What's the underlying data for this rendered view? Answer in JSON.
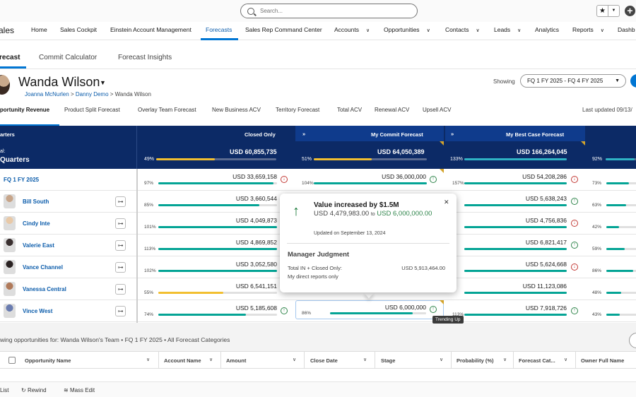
{
  "search": {
    "placeholder": "Search..."
  },
  "topbar": {
    "favorite_icon": "star-icon",
    "favorite_menu_icon": "chevron-down-icon",
    "add_icon": "plus-icon"
  },
  "nav": {
    "app_name": "ales",
    "items": [
      {
        "label": "Home",
        "chevron": false
      },
      {
        "label": "Sales Cockpit",
        "chevron": false
      },
      {
        "label": "Einstein Account Management",
        "chevron": false
      },
      {
        "label": "Forecasts",
        "chevron": false,
        "active": true
      },
      {
        "label": "Sales Rep Command Center",
        "chevron": false
      },
      {
        "label": "Accounts",
        "chevron": true
      },
      {
        "label": "Opportunities",
        "chevron": true
      },
      {
        "label": "Contacts",
        "chevron": true
      },
      {
        "label": "Leads",
        "chevron": true
      },
      {
        "label": "Analytics",
        "chevron": false
      },
      {
        "label": "Reports",
        "chevron": true
      },
      {
        "label": "Dashb",
        "chevron": false
      }
    ]
  },
  "subtabs": [
    "recast",
    "Commit Calculator",
    "Forecast Insights"
  ],
  "header": {
    "name": "Wanda Wilson",
    "breadcrumb": [
      "Joanna McNurlen",
      "Danny Demo",
      "Wanda Wilson"
    ],
    "breadcrumb_sep": ">",
    "showing_label": "Showing",
    "period": "FQ 1 FY 2025 - FQ 4 FY 2025",
    "forecast_tabs": [
      "pportunity Revenue",
      "Product Split Forecast",
      "Overlay Team Forecast",
      "New Business ACV",
      "Territory Forecast",
      "Total ACV",
      "Renewal ACV",
      "Upsell ACV"
    ],
    "last_updated": "Last updated 09/13/"
  },
  "grid": {
    "col0_label": "arters",
    "total_label": "al:",
    "total_sub": "Quarters",
    "columns": [
      {
        "label": "Closed Only",
        "total": "USD 60,855,735",
        "pct": "49%",
        "fill": 0.49
      },
      {
        "label": "My Commit Forecast",
        "total": "USD 64,050,389",
        "pct": "51%",
        "fill": 0.51
      },
      {
        "label": "My Best Case Forecast",
        "total": "USD 166,264,045",
        "pct": "133%",
        "fill": 1.0
      },
      {
        "label": "",
        "total": "",
        "pct": "92%",
        "fill": 0.92
      }
    ],
    "expand_icon": "»",
    "rows": [
      {
        "name": "FQ 1 FY 2025",
        "is_group": true,
        "cells": [
          {
            "amt": "USD 33,659,158",
            "pct": "97%",
            "fill": 0.97,
            "color": "teal",
            "trend": "down"
          },
          {
            "amt": "USD 36,000,000",
            "pct": "104%",
            "fill": 1.0,
            "color": "teal",
            "trend": "up"
          },
          {
            "amt": "USD 54,208,286",
            "pct": "157%",
            "fill": 1.0,
            "color": "teal",
            "trend": "down"
          },
          {
            "pct": "73%",
            "fill": 0.73,
            "color": "teal"
          }
        ]
      },
      {
        "name": "Bill South",
        "cells": [
          {
            "amt": "USD 3,660,544",
            "pct": "85%",
            "fill": 0.85,
            "color": "teal"
          },
          {},
          {
            "amt": "USD 5,638,243",
            "fill": 1.0,
            "color": "teal",
            "trend": "up"
          },
          {
            "pct": "63%",
            "fill": 0.63,
            "color": "teal"
          }
        ]
      },
      {
        "name": "Cindy Inte",
        "cells": [
          {
            "amt": "USD 4,049,873",
            "pct": "101%",
            "fill": 1.0,
            "color": "teal"
          },
          {},
          {
            "amt": "USD 4,756,836",
            "fill": 1.0,
            "color": "teal",
            "trend": "down"
          },
          {
            "pct": "42%",
            "fill": 0.42,
            "color": "teal"
          }
        ]
      },
      {
        "name": "Valerie East",
        "cells": [
          {
            "amt": "USD 4,869,852",
            "pct": "113%",
            "fill": 1.0,
            "color": "teal"
          },
          {},
          {
            "amt": "USD 6,821,417",
            "fill": 1.0,
            "color": "teal",
            "trend": "up"
          },
          {
            "pct": "59%",
            "fill": 0.59,
            "color": "teal"
          }
        ]
      },
      {
        "name": "Vance Channel",
        "cells": [
          {
            "amt": "USD 3,052,580",
            "pct": "102%",
            "fill": 1.0,
            "color": "teal"
          },
          {},
          {
            "amt": "USD 5,624,668",
            "fill": 1.0,
            "color": "teal",
            "trend": "down"
          },
          {
            "pct": "86%",
            "fill": 0.86,
            "color": "teal"
          }
        ]
      },
      {
        "name": "Vanessa Central",
        "cells": [
          {
            "amt": "USD 6,541,151",
            "pct": "55%",
            "fill": 0.55,
            "color": "gold"
          },
          {},
          {
            "amt": "USD 11,123,086",
            "fill": 1.0,
            "color": "teal"
          },
          {
            "pct": "48%",
            "fill": 0.48,
            "color": "teal"
          }
        ]
      },
      {
        "name": "Vince West",
        "cells": [
          {
            "amt": "USD 5,185,608",
            "pct": "74%",
            "fill": 0.74,
            "color": "teal",
            "trend": "up"
          },
          {
            "amt": "USD 6,000,000",
            "pct": "86%",
            "fill": 0.86,
            "color": "teal",
            "trend": "up"
          },
          {
            "amt": "USD 7,918,726",
            "pct": "113%",
            "fill": 1.0,
            "color": "teal",
            "trend": "up"
          },
          {
            "pct": "43%",
            "fill": 0.43,
            "color": "teal"
          }
        ]
      }
    ]
  },
  "popover": {
    "title": "Value increased by $1.5M",
    "from": "USD 4,479,983.00",
    "to_word": "to",
    "to": "USD 6,000,000.00",
    "updated": "Updated on September 13, 2024",
    "section": "Manager Judgment",
    "total_label": "Total IN + Closed Only:",
    "total_value": "USD 5,913,464.00",
    "direct": "My direct reports only",
    "close_icon": "close-icon"
  },
  "tooltip": "Trending Up",
  "opportunities": {
    "title": "wing opportunities for: Wanda Wilson's Team  •  FQ 1 FY 2025  •  All Forecast Categories",
    "columns": [
      "Opportunity Name",
      "Account Name",
      "Amount",
      "Close Date",
      "Stage",
      "Probability (%)",
      "Forecast Cat...",
      "Owner Full Name"
    ]
  },
  "footer": {
    "list": "List",
    "rewind": "Rewind",
    "mass_edit": "Mass Edit"
  },
  "colors": {
    "teal": "#04a495",
    "gold": "#f2bf30",
    "navy": "#0c2a66",
    "brand": "#0176d3"
  }
}
